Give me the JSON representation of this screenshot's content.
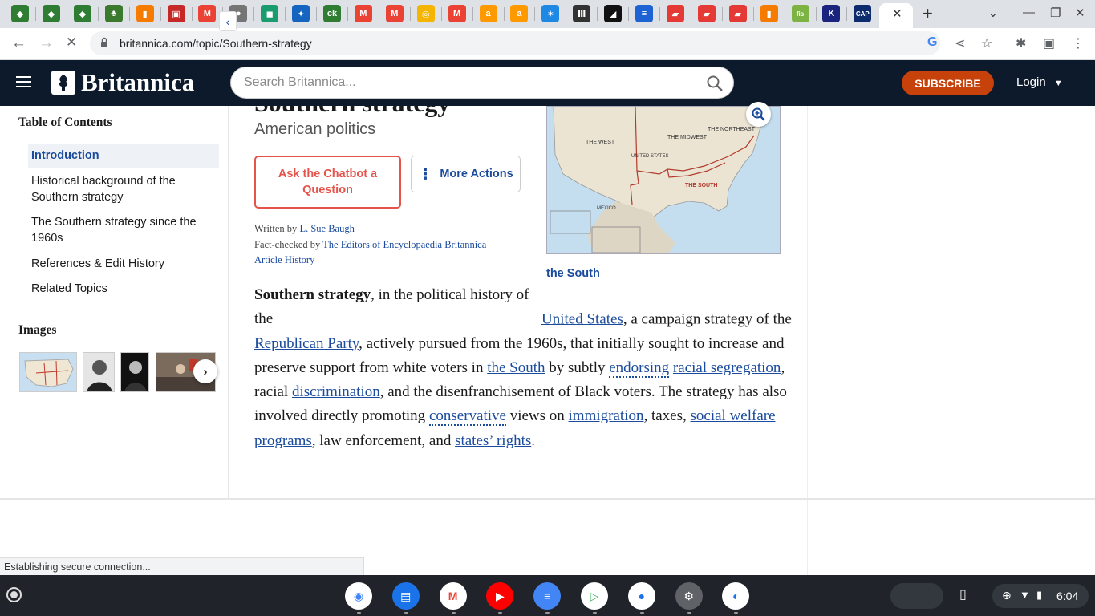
{
  "browser": {
    "tab_icons": [
      {
        "name": "classroom-icon",
        "color": "#2e7d32",
        "glyph": "◆"
      },
      {
        "name": "classroom-icon",
        "color": "#2e7d32",
        "glyph": "◆"
      },
      {
        "name": "classroom-icon",
        "color": "#2e7d32",
        "glyph": "◆"
      },
      {
        "name": "plant-icon",
        "color": "#3b7a2e",
        "glyph": "♣"
      },
      {
        "name": "slides-icon",
        "color": "#f57c00",
        "glyph": "▮"
      },
      {
        "name": "gift-icon",
        "color": "#c62828",
        "glyph": "▣"
      },
      {
        "name": "gmail-icon",
        "color": "#ea4335",
        "glyph": "M"
      },
      {
        "name": "globe-icon",
        "color": "#757575",
        "glyph": "●"
      },
      {
        "name": "quizlet-icon",
        "color": "#1b9c6f",
        "glyph": "◼"
      },
      {
        "name": "dropbox-icon",
        "color": "#1565c0",
        "glyph": "✦"
      },
      {
        "name": "ck12-icon",
        "color": "#2e7d32",
        "glyph": "ck"
      },
      {
        "name": "gmail-icon",
        "color": "#ea4335",
        "glyph": "M"
      },
      {
        "name": "gmail-icon",
        "color": "#ea4335",
        "glyph": "M"
      },
      {
        "name": "chrome-icon",
        "color": "#f4b400",
        "glyph": "◎"
      },
      {
        "name": "gmail-icon",
        "color": "#ea4335",
        "glyph": "M"
      },
      {
        "name": "amazon-icon",
        "color": "#ff9900",
        "glyph": "a"
      },
      {
        "name": "amazon-icon",
        "color": "#ff9900",
        "glyph": "a"
      },
      {
        "name": "butterfly-icon",
        "color": "#1e88e5",
        "glyph": "✶"
      },
      {
        "name": "library-icon",
        "color": "#333333",
        "glyph": "Ⅲ"
      },
      {
        "name": "code-icon",
        "color": "#111111",
        "glyph": "◢"
      },
      {
        "name": "docs-icon",
        "color": "#1e63d3",
        "glyph": "≡"
      },
      {
        "name": "bookmark-icon",
        "color": "#e53935",
        "glyph": "▰"
      },
      {
        "name": "bookmark-icon",
        "color": "#e53935",
        "glyph": "▰"
      },
      {
        "name": "bookmark-icon",
        "color": "#e53935",
        "glyph": "▰"
      },
      {
        "name": "slides-icon",
        "color": "#f57c00",
        "glyph": "▮"
      },
      {
        "name": "fis-icon",
        "color": "#7cb342",
        "glyph": "fis"
      },
      {
        "name": "k-icon",
        "color": "#1a237e",
        "glyph": "K"
      },
      {
        "name": "cap-icon",
        "color": "#0d2c6e",
        "glyph": "CAP"
      }
    ],
    "url": "britannica.com/topic/Southern-strategy",
    "status_text": "Establishing secure connection..."
  },
  "header": {
    "logo_text": "Britannica",
    "search_placeholder": "Search Britannica...",
    "subscribe_label": "SUBSCRIBE",
    "login_label": "Login"
  },
  "sidebar": {
    "toc_title": "Table of Contents",
    "items": [
      {
        "label": "Introduction",
        "active": true
      },
      {
        "label": "Historical background of the Southern strategy",
        "active": false
      },
      {
        "label": "The Southern strategy since the 1960s",
        "active": false
      },
      {
        "label": "References & Edit History",
        "active": false
      },
      {
        "label": "Related Topics",
        "active": false
      }
    ],
    "images_title": "Images"
  },
  "article": {
    "title": "Southern strategy",
    "subtitle": "American politics",
    "chatbot_label": "Ask the Chatbot a Question",
    "more_actions_label": "More Actions",
    "written_by_label": "Written by",
    "author": "L. Sue Baugh",
    "fact_checked_label": "Fact-checked by",
    "fact_checker": "The Editors of Encyclopaedia Britannica",
    "history_link": "Article History",
    "map_caption": "the South",
    "map_labels": {
      "west": "THE WEST",
      "midwest": "THE MIDWEST",
      "northeast": "THE NORTHEAST",
      "south": "THE SOUTH",
      "country": "UNITED STATES",
      "mexico": "MEXICO"
    },
    "body": {
      "lead": "Southern strategy",
      "t1": ", in the political history of the ",
      "l1": "United States",
      "t2": ", a campaign strategy of the ",
      "l2": "Republican Party",
      "t3": ", actively pursued from the 1960s, that initially sought to increase and preserve support from white voters in ",
      "l3": "the South",
      "t4": " by subtly ",
      "d1": "endorsing",
      "t5": " ",
      "l4": "racial segregation",
      "t6": ", racial ",
      "l5": "discrimination",
      "t7": ", and the disenfranchisement of Black voters. The strategy has also involved directly promoting ",
      "d2": "conservative",
      "t8": " views on ",
      "l6": "immigration",
      "t9": ", taxes, ",
      "l7": "social welfare programs",
      "t10": ", law enforcement, and ",
      "l8": "states’ rights",
      "t11": "."
    }
  },
  "shelf": {
    "apps": [
      {
        "name": "chrome-app-icon",
        "color": "#ffffff"
      },
      {
        "name": "files-app-icon",
        "color": "#1a73e8"
      },
      {
        "name": "gmail-app-icon",
        "color": "#ffffff"
      },
      {
        "name": "youtube-app-icon",
        "color": "#ff0000"
      },
      {
        "name": "docs-app-icon",
        "color": "#4285f4"
      },
      {
        "name": "play-store-app-icon",
        "color": "#ffffff"
      },
      {
        "name": "messages-app-icon",
        "color": "#ffffff"
      },
      {
        "name": "settings-app-icon",
        "color": "#5f6368"
      },
      {
        "name": "screencast-app-icon",
        "color": "#ffffff"
      }
    ],
    "clock": "6:04"
  }
}
